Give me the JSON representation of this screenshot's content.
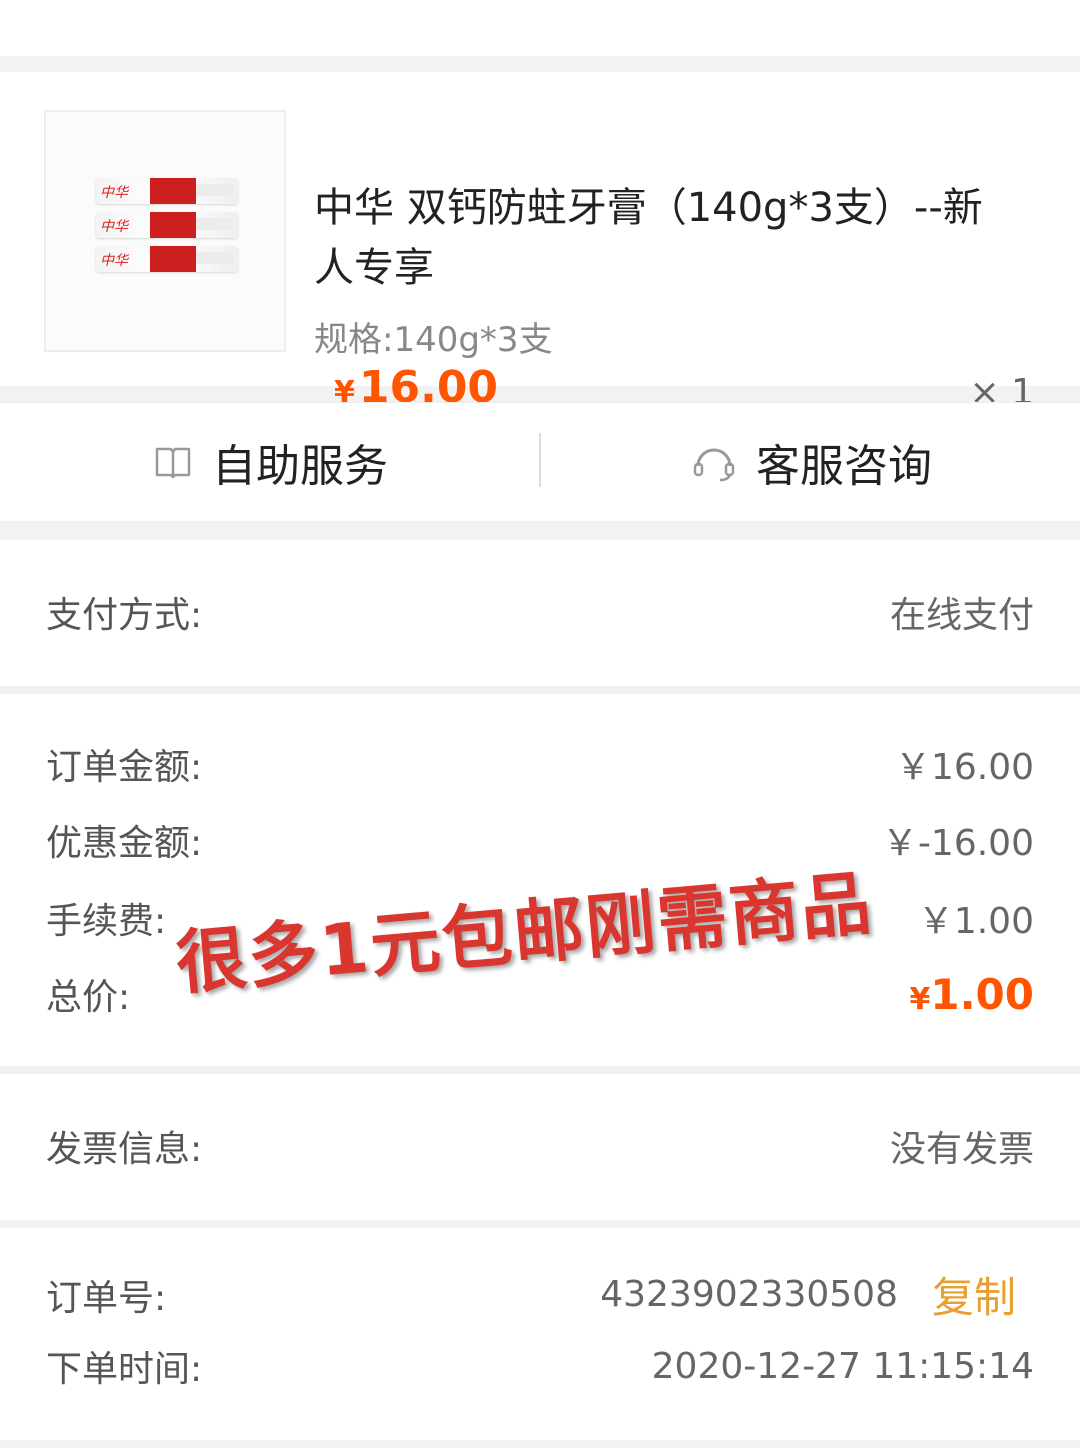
{
  "product": {
    "title": "中华 双钙防蛀牙膏（140g*3支）--新人专享",
    "spec": "规格:140g*3支",
    "currency": "¥",
    "price": "16.00",
    "quantity": "× 1",
    "image_brand": "中华"
  },
  "actions": {
    "self_service": "自助服务",
    "customer_service": "客服咨询"
  },
  "payment": {
    "label": "支付方式:",
    "value": "在线支付"
  },
  "amounts": {
    "order_amount_label": "订单金额:",
    "order_amount_value": "￥16.00",
    "discount_label": "优惠金额:",
    "discount_value": "￥-16.00",
    "fee_label": "手续费:",
    "fee_value": "￥1.00",
    "total_label": "总价:",
    "total_currency": "¥",
    "total_value": "1.00"
  },
  "watermark": "很多1元包邮刚需商品",
  "invoice": {
    "label": "发票信息:",
    "value": "没有发票"
  },
  "order": {
    "number_label": "订单号:",
    "number_value": "4323902330508",
    "copy_label": "复制",
    "time_label": "下单时间:",
    "time_value": "2020-12-27 11:15:14"
  },
  "colors": {
    "accent": "#ff5500",
    "copy": "#e8a030",
    "watermark": "#d8362e"
  }
}
